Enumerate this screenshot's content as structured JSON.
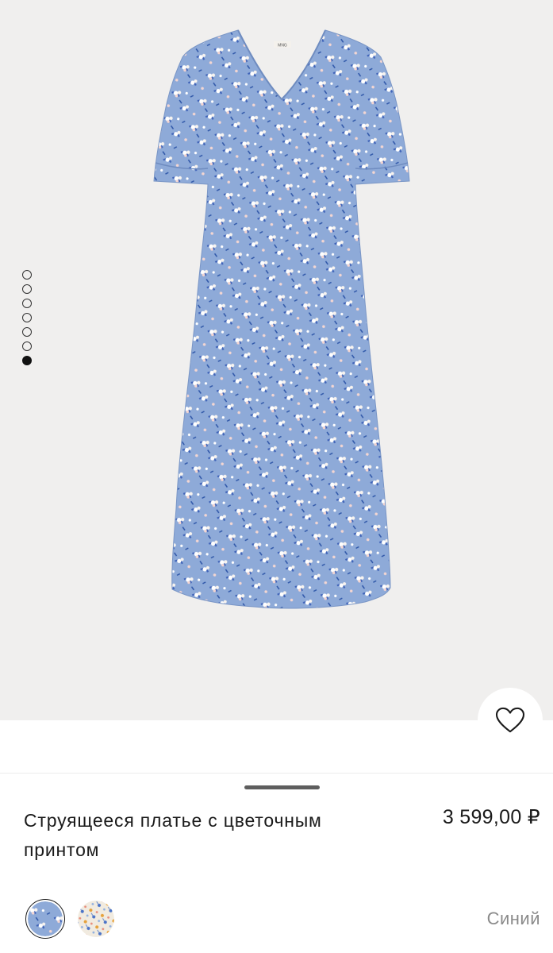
{
  "gallery": {
    "image_alt": "Струящееся платье с цветочным принтом",
    "label_tag": "MNG",
    "pager": {
      "total": 7,
      "active_index": 6
    }
  },
  "favorite": {
    "icon": "heart-outline-icon"
  },
  "product": {
    "title": "Струящееся платье с цветочным принтом",
    "price": "3 599,00 ₽",
    "color_name": "Синий",
    "swatches": [
      {
        "name": "blue-floral",
        "selected": true,
        "color": "#8eaad8"
      },
      {
        "name": "cream-floral",
        "selected": false,
        "color": "#f1ebe0"
      }
    ]
  },
  "colors": {
    "background_gallery": "#f0efee",
    "dress_base": "#8eaad8",
    "text": "#1a1a1a",
    "muted_text": "#8a8a8a"
  }
}
